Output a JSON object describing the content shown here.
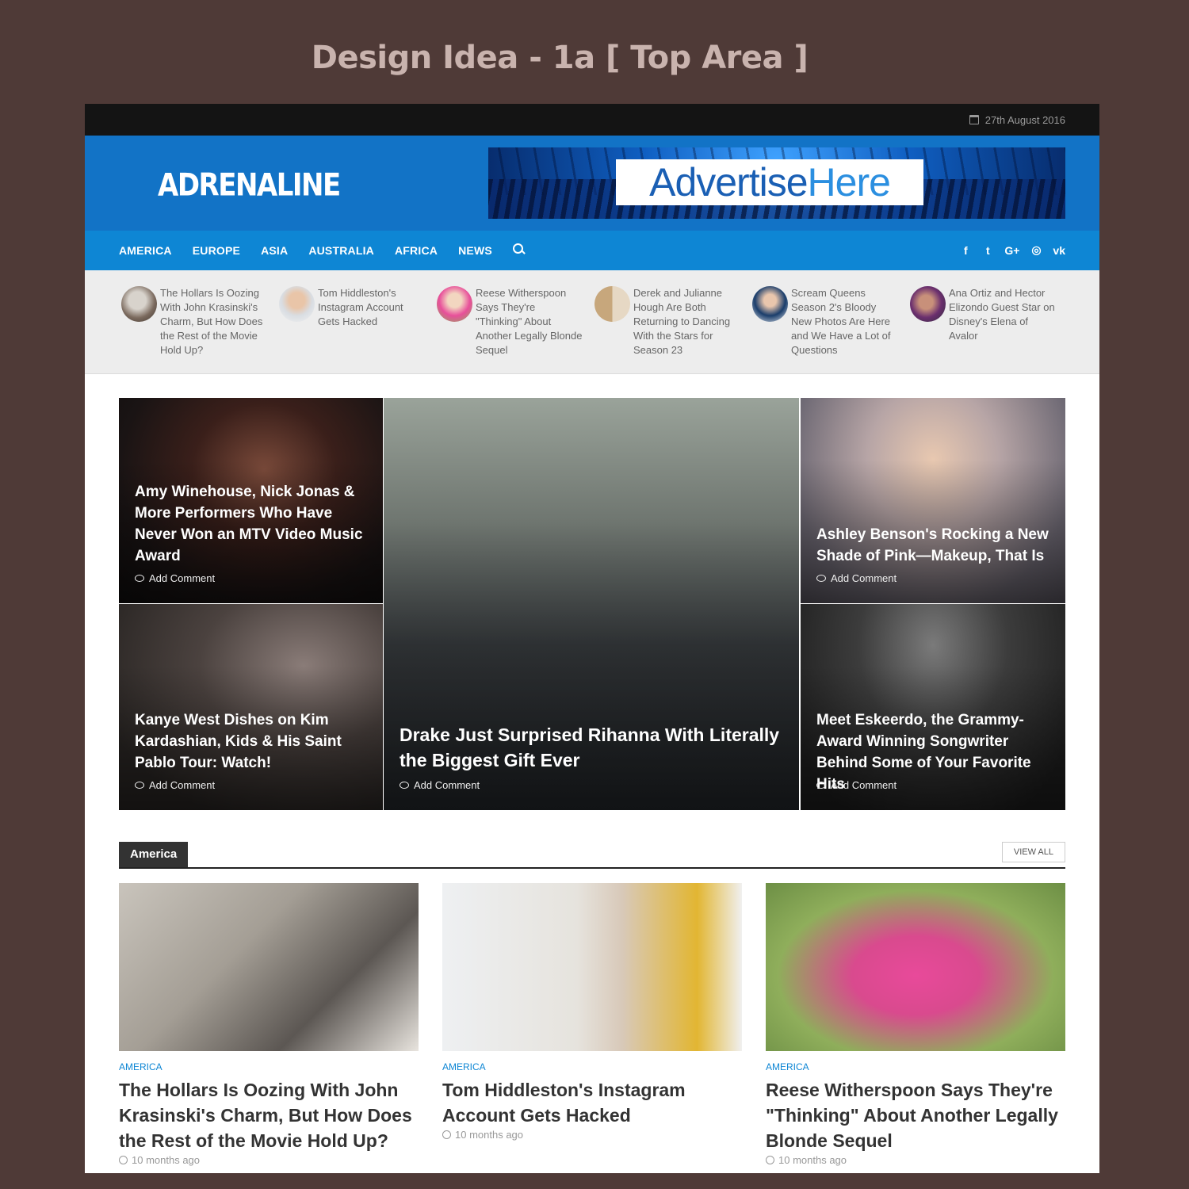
{
  "design_title": "Design Idea - 1a   [ Top Area ]",
  "topbar": {
    "date": "27th August 2016",
    "date_icon": "calendar-icon"
  },
  "header": {
    "logo": "ADRENALINE",
    "banner": {
      "text_a": "Advertise",
      "text_b": "Here"
    }
  },
  "nav": {
    "items": [
      "AMERICA",
      "EUROPE",
      "ASIA",
      "AUSTRALIA",
      "AFRICA",
      "NEWS"
    ],
    "search_icon": "search-icon",
    "social": [
      "f",
      "t",
      "G+",
      "◎",
      "vk"
    ]
  },
  "ticker": [
    {
      "title": "The Hollars Is Oozing With John Krasinski's Charm, But How Does the Rest of the Movie Hold Up?"
    },
    {
      "title": "Tom Hiddleston's Instagram Account Gets Hacked"
    },
    {
      "title": "Reese Witherspoon Says They're \"Thinking\" About Another Legally Blonde Sequel"
    },
    {
      "title": "Derek and Julianne Hough Are Both Returning to Dancing With the Stars for Season 23"
    },
    {
      "title": "Scream Queens Season 2's Bloody New Photos Are Here and We Have a Lot of Questions"
    },
    {
      "title": "Ana Ortiz and Hector Elizondo Guest Star on Disney's Elena of Avalor"
    }
  ],
  "featured": {
    "comment_label": "Add Comment",
    "tiles": [
      {
        "title": "Amy Winehouse, Nick Jonas & More Performers Who Have Never Won an MTV Video Music Award"
      },
      {
        "title": "Kanye West Dishes on Kim Kardashian, Kids & His Saint Pablo Tour: Watch!"
      },
      {
        "title": "Drake Just Surprised Rihanna With Literally the Biggest Gift Ever"
      },
      {
        "title": "Ashley Benson's Rocking a New Shade of Pink—Makeup, That Is"
      },
      {
        "title": "Meet Eskeerdo, the Grammy-Award Winning Songwriter Behind Some of Your Favorite Hits"
      }
    ]
  },
  "section": {
    "title": "America",
    "view_all": "VIEW ALL",
    "cards": [
      {
        "category": "AMERICA",
        "title": "The Hollars Is Oozing With John Krasinski's Charm, But How Does the Rest of the Movie Hold Up?",
        "date": "10 months ago"
      },
      {
        "category": "AMERICA",
        "title": "Tom Hiddleston's Instagram Account Gets Hacked",
        "date": "10 months ago"
      },
      {
        "category": "AMERICA",
        "title": "Reese Witherspoon Says They're \"Thinking\" About Another Legally Blonde Sequel",
        "date": "10 months ago"
      }
    ]
  },
  "colors": {
    "brand_blue": "#1273c6",
    "nav_blue": "#0e86d4",
    "topbar": "#141414",
    "backdrop": "#4f3a37"
  }
}
